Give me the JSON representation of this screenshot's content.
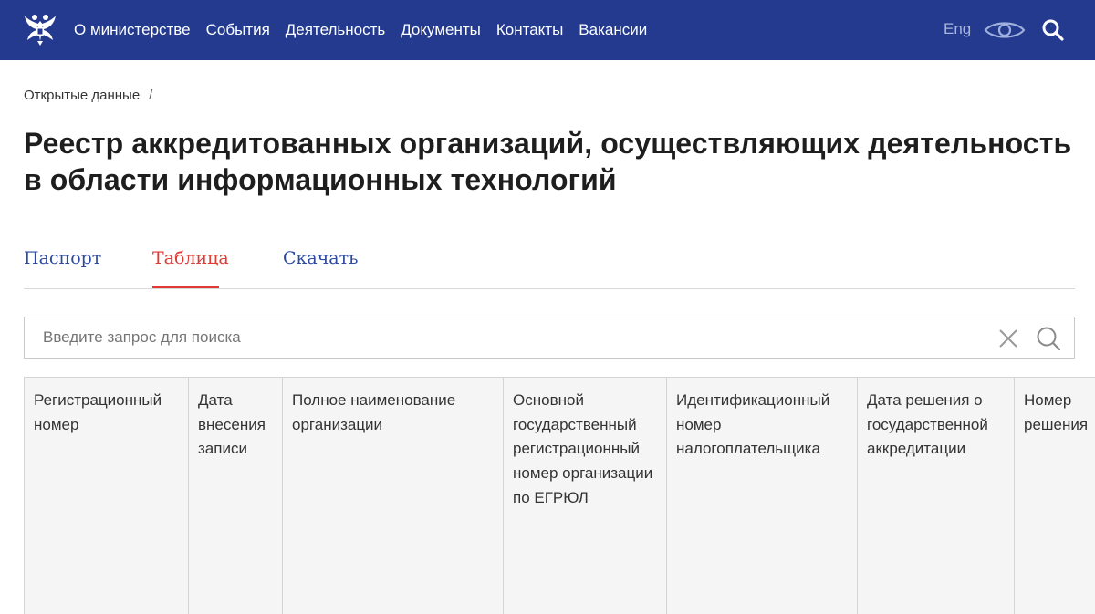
{
  "header": {
    "nav": [
      "О министерстве",
      "События",
      "Деятельность",
      "Документы",
      "Контакты",
      "Вакансии"
    ],
    "lang_label": "Eng",
    "icons": {
      "emblem": "coat-of-arms-icon",
      "accessibility": "eye-icon",
      "search": "search-icon"
    }
  },
  "breadcrumb": {
    "item": "Открытые данные",
    "separator": "/"
  },
  "page": {
    "title": "Реестр аккредитованных организаций, осуществляющих деятельность в области информационных технологий"
  },
  "tabs": [
    {
      "label": "Паспорт",
      "active": false
    },
    {
      "label": "Таблица",
      "active": true
    },
    {
      "label": "Скачать",
      "active": false
    }
  ],
  "search": {
    "placeholder": "Введите запрос для поиска",
    "value": ""
  },
  "table": {
    "columns": [
      "Регистрационный номер",
      "Дата внесения записи",
      "Полное наименование организации",
      "Основной государственный регистрационный номер организации по ЕГРЮЛ",
      "Идентификационный номер налогоплательщика",
      "Дата решения о государственной аккредитации",
      "Номер решения"
    ]
  },
  "colors": {
    "header_bg": "#233a8f",
    "accent_red": "#e03a35",
    "link_blue": "#2c4aa0"
  }
}
